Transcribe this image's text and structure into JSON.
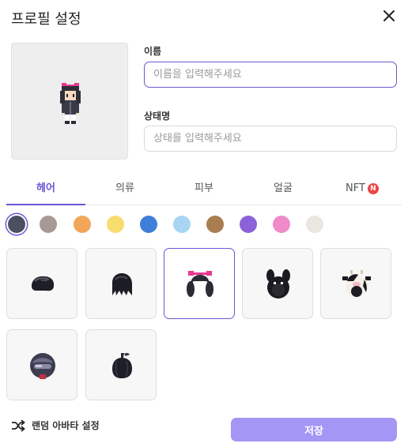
{
  "dialog": {
    "title": "프로필 설정"
  },
  "form": {
    "name_label": "이름",
    "name_value": "",
    "name_placeholder": "이름을 입력해주세요",
    "status_label": "상태명",
    "status_value": "",
    "status_placeholder": "상태를 입력해주세요"
  },
  "tabs": [
    {
      "label": "헤어",
      "active": true
    },
    {
      "label": "의류",
      "active": false
    },
    {
      "label": "피부",
      "active": false
    },
    {
      "label": "얼굴",
      "active": false
    },
    {
      "label": "NFT",
      "active": false,
      "badge": "N"
    }
  ],
  "colors": {
    "accent": "#6b57d6",
    "swatches": [
      "#4b4f60",
      "#a59a94",
      "#f2a65a",
      "#f7dc6f",
      "#3f7fd9",
      "#a8d5f2",
      "#a87d50",
      "#8b62d9",
      "#f08ac8",
      "#e9e7df"
    ],
    "selected_swatch": 0
  },
  "hair_items": [
    {
      "icon": "short-hair-icon"
    },
    {
      "icon": "spiky-hair-icon"
    },
    {
      "icon": "pigtails-bow-hair-icon",
      "selected": true
    },
    {
      "icon": "bunny-hood-icon"
    },
    {
      "icon": "cow-hood-icon"
    },
    {
      "icon": "helmet-icon"
    },
    {
      "icon": "pumpkin-hair-icon"
    }
  ],
  "footer": {
    "random_label": "랜덤 아바타 설정",
    "save_label": "저장"
  }
}
